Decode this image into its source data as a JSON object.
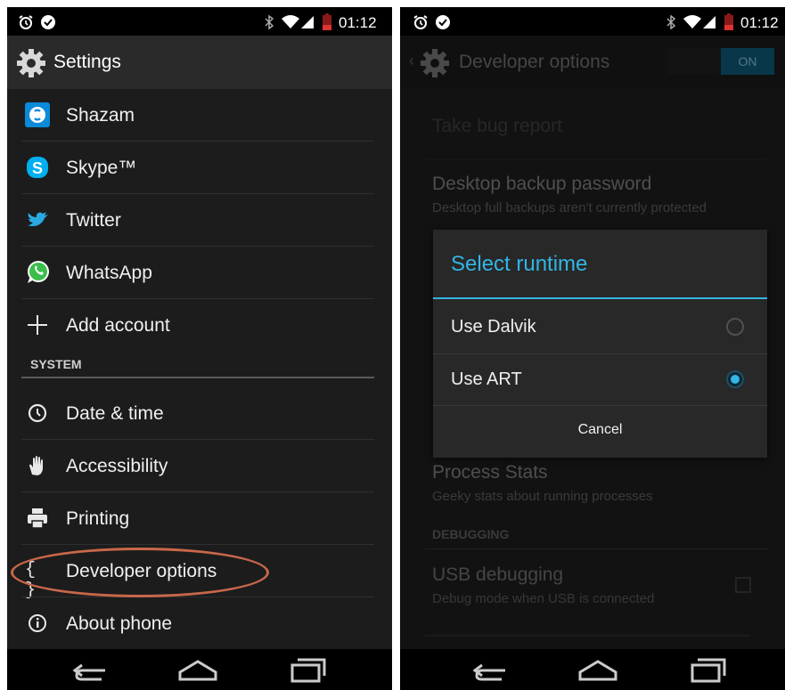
{
  "left": {
    "status_time": "01:12",
    "header": {
      "title": "Settings",
      "icon": "gear-icon"
    },
    "items_top": [
      {
        "label": "Shazam",
        "icon": "shazam-icon"
      },
      {
        "label": "Skype™",
        "icon": "skype-icon"
      },
      {
        "label": "Twitter",
        "icon": "twitter-icon"
      },
      {
        "label": "WhatsApp",
        "icon": "whatsapp-icon"
      },
      {
        "label": "Add account",
        "icon": "plus-icon"
      }
    ],
    "section": "SYSTEM",
    "items_system": [
      {
        "label": "Date & time",
        "icon": "clock-icon"
      },
      {
        "label": "Accessibility",
        "icon": "hand-icon"
      },
      {
        "label": "Printing",
        "icon": "printer-icon"
      },
      {
        "label": "Developer options",
        "icon": "braces-icon"
      },
      {
        "label": "About phone",
        "icon": "info-icon"
      }
    ],
    "developer_icon_text": "{ }",
    "highlight_color": "#c8674a"
  },
  "right": {
    "status_time": "01:12",
    "header": {
      "title": "Developer options",
      "toggle": "ON"
    },
    "prefs": {
      "bug_report": "Take bug report",
      "backup_title": "Desktop backup password",
      "backup_summary": "Desktop full backups aren't currently protected",
      "process_title": "Process Stats",
      "process_summary": "Geeky stats about running processes",
      "debugging_header": "DEBUGGING",
      "usb_title": "USB debugging",
      "usb_summary": "Debug mode when USB is connected"
    },
    "dialog": {
      "title": "Select runtime",
      "options": [
        {
          "label": "Use Dalvik",
          "selected": false
        },
        {
          "label": "Use ART",
          "selected": true
        }
      ],
      "cancel": "Cancel"
    },
    "accent_color": "#33b5e5"
  }
}
